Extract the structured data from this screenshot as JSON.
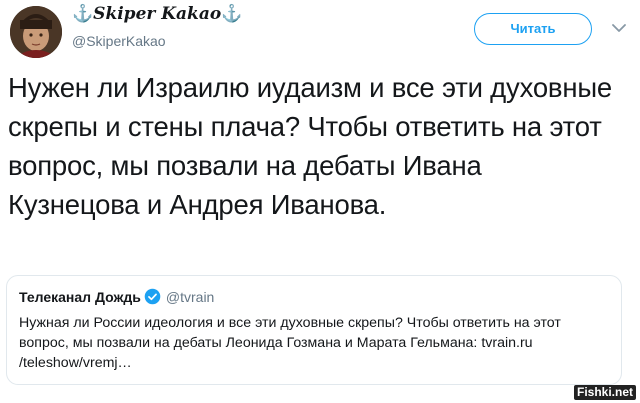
{
  "tweet": {
    "author": {
      "anchor_left": "⚓",
      "display_name": "Skiper Kakao",
      "anchor_right": "⚓",
      "handle": "@SkiperKakao"
    },
    "follow_label": "Читать",
    "text": "Нужен ли Израилю иудаизм и все эти духовные скрепы и стены плача? Чтобы ответить на этот вопрос, мы позвали на дебаты Ивана Кузнецова и Андрея Иванова.",
    "quote": {
      "name": "Телеканал Дождь",
      "handle": "@tvrain",
      "text": "Нужная ли России идеология и все эти духовные скрепы? Чтобы ответить на этот вопрос, мы позвали на дебаты Леонида Гозмана и Марата Гельмана: tvrain.ru /teleshow/vremj…"
    }
  },
  "watermark": "Fishki.net",
  "colors": {
    "accent": "#1da1f2",
    "text": "#14171a",
    "secondary": "#657786",
    "border": "#e1e8ed"
  },
  "icons": {
    "caret": "chevron-down-icon",
    "verified": "verified-badge-icon"
  }
}
